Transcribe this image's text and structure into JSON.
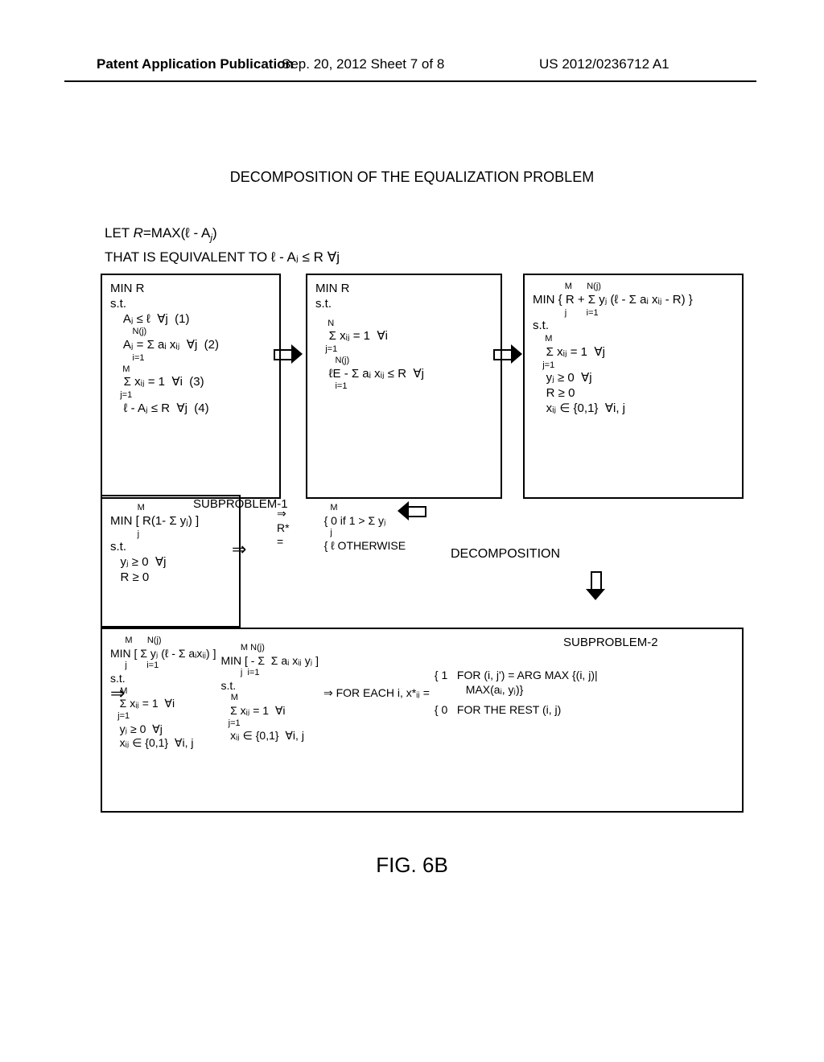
{
  "header": {
    "left": "Patent Application Publication",
    "center": "Sep. 20, 2012  Sheet 7 of 8",
    "right": "US 2012/0236712 A1"
  },
  "title": "DECOMPOSITION OF THE EQUALIZATION PROBLEM",
  "defs": {
    "line1_a": "LET ",
    "line1_b": "R",
    "line1_c": "=MAX(ℓ - A",
    "line1_d": "j",
    "line1_e": ")",
    "line2": "THAT IS EQUIVALENT TO ℓ - Aⱼ ≤ R  ∀j"
  },
  "boxA": {
    "l1": "MIN R",
    "l2": "s.t.",
    "l3": "    Aⱼ ≤ ℓ  ∀j  (1)",
    "l4a": "         N(j)",
    "l4": "    Aⱼ = Σ aᵢ xᵢⱼ  ∀j  (2)",
    "l4b": "         i=1",
    "l5a": "     M",
    "l5": "    Σ xᵢⱼ = 1  ∀i  (3)",
    "l5b": "    j=1",
    "l6": "    ℓ - Aⱼ ≤ R  ∀j  (4)"
  },
  "boxB": {
    "l1": "MIN R",
    "l2": "s.t.",
    "l3a": "     N",
    "l3": "    Σ xᵢⱼ = 1  ∀i",
    "l3b": "    j=1",
    "l4a": "        N(j)",
    "l4": "    ℓE - Σ aᵢ xᵢⱼ ≤ R  ∀j",
    "l4b": "        i=1"
  },
  "boxC": {
    "l1a": "             M      N(j)",
    "l1": "MIN { R + Σ yⱼ (ℓ - Σ aᵢ xᵢⱼ - R) }",
    "l1b": "             j        i=1",
    "l2": "s.t.",
    "l3a": "     M",
    "l3": "    Σ xᵢⱼ = 1  ∀j",
    "l3b": "    j=1",
    "l4": "    yⱼ ≥ 0  ∀j",
    "l5": "    R ≥ 0",
    "l6": "    xᵢⱼ ∈ {0,1}  ∀i, j"
  },
  "sub1_label": "SUBPROBLEM-1",
  "boxD1": {
    "l1a": "           M",
    "l1": "MIN [ R(1- Σ yⱼ) ]",
    "l1b": "           j",
    "l2": "s.t.",
    "l3": "   yⱼ ≥ 0  ∀j",
    "l4": "   R ≥ 0"
  },
  "boxD2": {
    "l1a": "              M",
    "l1p": "         { 0 if 1 > Σ yⱼ",
    "l1b": "              j",
    "l0": "⇒ R* =",
    "l2": "         { ℓ OTHERWISE"
  },
  "decomp_label": "DECOMPOSITION",
  "sub2_label": "SUBPROBLEM-2",
  "boxE": {
    "col1": {
      "l1a": "      M      N(j)",
      "l1": "MIN [ Σ yⱼ (ℓ - Σ aᵢxᵢⱼ) ]",
      "l1b": "      j        i=1",
      "l2": "s.t.",
      "l3a": "    M",
      "l3": "   Σ xᵢⱼ = 1  ∀i",
      "l3b": "   j=1",
      "l4": "   yⱼ ≥ 0  ∀j",
      "l5": "   xᵢⱼ ∈ {0,1}  ∀i, j"
    },
    "col2": {
      "l1a": "        M N(j)",
      "l1": "MIN [ - Σ  Σ aᵢ xᵢⱼ yⱼ ]",
      "l1b": "        j  i=1",
      "l2": "s.t.",
      "l3a": "    M",
      "l3": "   Σ xᵢⱼ = 1  ∀i",
      "l3b": "   j=1",
      "l4": "   xᵢⱼ ∈ {0,1}  ∀i, j"
    },
    "col3": {
      "lead": "⇒ FOR EACH i, x*ᵢⱼ =",
      "r1a": "{ 1   FOR (i, j') = ARG MAX {(i, j)|",
      "r1b": "          MAX(aᵢ, yⱼ)}",
      "r2": "{ 0   FOR THE REST (i, j)"
    }
  },
  "figcap": "FIG. 6B"
}
